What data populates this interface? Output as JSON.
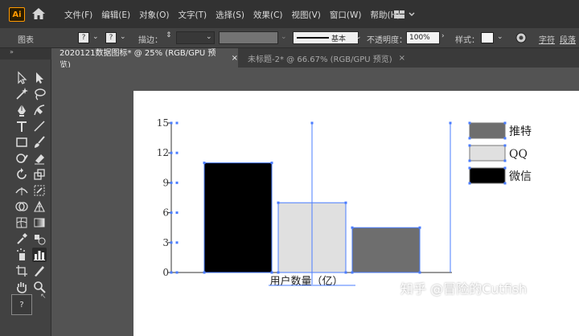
{
  "app": {
    "logo_text": "Ai"
  },
  "menu": [
    "文件(F)",
    "编辑(E)",
    "对象(O)",
    "文字(T)",
    "选择(S)",
    "效果(C)",
    "视图(V)",
    "窗口(W)",
    "帮助(H)"
  ],
  "control_bar": {
    "object_label": "图表",
    "fill_symbol": "?",
    "stroke_symbol": "?",
    "stroke_label": "描边：",
    "stroke_style_label": "基本",
    "opacity_label": "不透明度：",
    "opacity_value": "100%",
    "style_label": "样式：",
    "char_label": "字符",
    "para_label": "段落"
  },
  "tabs": [
    {
      "label": "2020121数据图标* @ 25% (RGB/GPU 预览)",
      "close": "×",
      "active": true
    },
    {
      "label": "未标题-2* @ 66.67% (RGB/GPU 预览)",
      "close": "×",
      "active": false
    }
  ],
  "tool_panel": {
    "header": "\"",
    "fill_stroke_symbol": "?"
  },
  "chart_data": {
    "type": "bar",
    "categories": [
      "推特",
      "QQ",
      "微信"
    ],
    "series": [
      {
        "name": "微信",
        "value": 11,
        "color": "#000000"
      },
      {
        "name": "QQ",
        "value": 7,
        "color": "#e0e0e0"
      },
      {
        "name": "推特",
        "value": 4.5,
        "color": "#6e6e6e"
      }
    ],
    "y_ticks": [
      "0",
      "3",
      "6",
      "9",
      "12",
      "15"
    ],
    "ylim": [
      0,
      15
    ],
    "xlabel": "用户数量（亿）",
    "legend": [
      {
        "label": "推特",
        "color": "#6e6e6e"
      },
      {
        "label": "QQ",
        "color": "#e0e0e0"
      },
      {
        "label": "微信",
        "color": "#000000"
      }
    ],
    "legend_position": "top-right",
    "selection_color": "#4a7cff"
  },
  "watermark": "知乎 @冒险的Cutfish"
}
